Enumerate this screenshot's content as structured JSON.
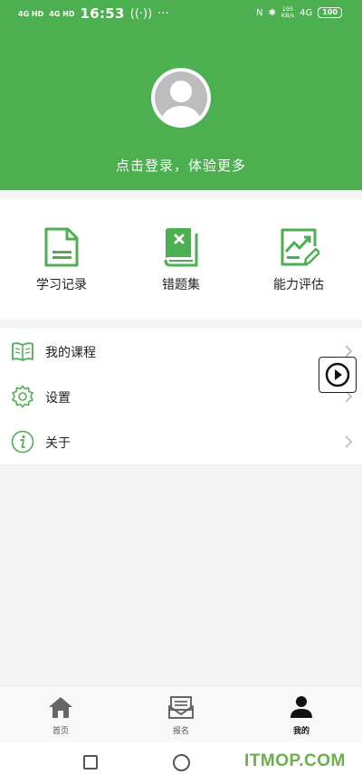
{
  "status_bar": {
    "network_1": "4G HD",
    "network_2": "4G HD",
    "time": "16:53",
    "speed_value": "195",
    "speed_unit": "KB/s",
    "signal": "4G",
    "battery": "100"
  },
  "header": {
    "login_prompt": "点击登录，体验更多"
  },
  "features": [
    {
      "label": "学习记录",
      "icon": "document-icon"
    },
    {
      "label": "错题集",
      "icon": "book-x-icon"
    },
    {
      "label": "能力评估",
      "icon": "chart-edit-icon"
    }
  ],
  "menu": [
    {
      "label": "我的课程",
      "icon": "open-book-icon"
    },
    {
      "label": "设置",
      "icon": "gear-icon"
    },
    {
      "label": "关于",
      "icon": "info-icon"
    }
  ],
  "tabs": [
    {
      "label": "首页",
      "icon": "home-icon"
    },
    {
      "label": "报名",
      "icon": "mail-icon"
    },
    {
      "label": "我的",
      "icon": "person-icon",
      "active": true
    }
  ],
  "watermark": "ITMOP.COM",
  "colors": {
    "primary": "#4caf50",
    "background": "#f4f4f4"
  }
}
